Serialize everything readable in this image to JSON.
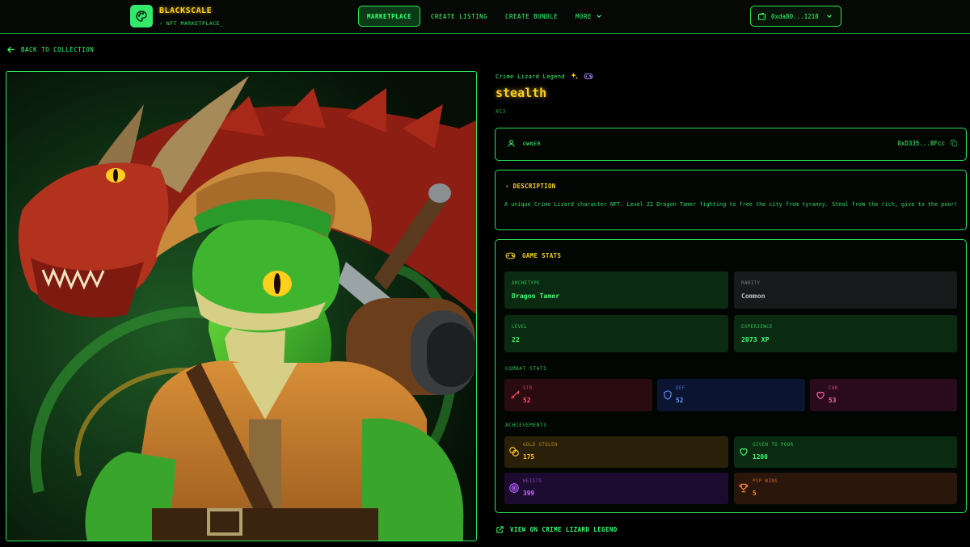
{
  "header": {
    "brand_name": "BLACKSCALE",
    "brand_sub": "› NFT MARKETPLACE_",
    "nav": [
      {
        "label": "MARKETPLACE"
      },
      {
        "label": "CREATE LISTING"
      },
      {
        "label": "CREATE BUNDLE"
      },
      {
        "label": "MORE"
      }
    ],
    "wallet_address": "0xda80...1218"
  },
  "back_link": "BACK TO COLLECTION",
  "nft": {
    "collection": "Crime Lizard Legend",
    "name": "stealth",
    "token_id": "#13",
    "owner_label": "OWNER",
    "owner_address": "0xD335...8Fcc",
    "description_title": "› DESCRIPTION",
    "description": "A unique Crime Lizard character NFT. Level 22 Dragon Tamer fighting to free the city from tyranny. Steal from the rich, give to the poor!"
  },
  "game_stats": {
    "title": "GAME STATS",
    "info": [
      {
        "label": "ARCHETYPE",
        "value": "Dragon Tamer"
      },
      {
        "label": "RARITY",
        "value": "Common"
      },
      {
        "label": "LEVEL",
        "value": "22"
      },
      {
        "label": "EXPERIENCE",
        "value": "2073 XP"
      }
    ],
    "combat_label": "COMBAT STATS",
    "combat": [
      {
        "label": "STR",
        "value": "52",
        "icon": "sword-icon"
      },
      {
        "label": "DEF",
        "value": "52",
        "icon": "shield-icon"
      },
      {
        "label": "CHR",
        "value": "53",
        "icon": "heart-icon"
      }
    ],
    "achievements_label": "ACHIEVEMENTS",
    "achievements": [
      {
        "label": "GOLD STOLEN",
        "value": "175",
        "icon": "coins-icon"
      },
      {
        "label": "GIVEN TO POOR",
        "value": "1200",
        "icon": "heart-icon"
      },
      {
        "label": "HEISTS",
        "value": "399",
        "icon": "target-icon"
      },
      {
        "label": "PVP WINS",
        "value": "5",
        "icon": "trophy-icon"
      }
    ]
  },
  "view_link": "VIEW ON CRIME LIZARD LEGEND",
  "colors": {
    "accent_green": "#3dff6e",
    "accent_gold": "#ffd21c",
    "background": "#000000",
    "str": "#ff4d5e",
    "def": "#5b8cff",
    "chr": "#ff5fa8",
    "gold": "#ffc21c",
    "purple": "#b65cff",
    "orange": "#ff8a3c"
  }
}
